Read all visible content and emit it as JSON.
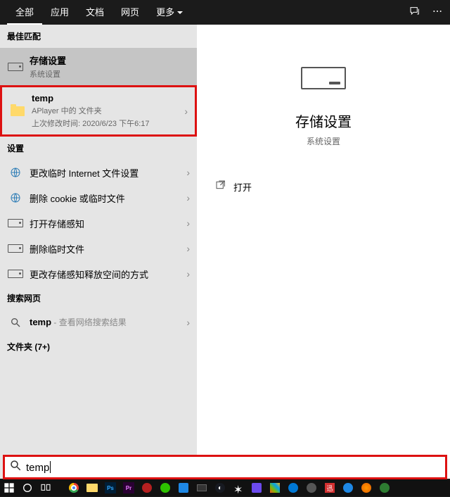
{
  "tabs": {
    "all": "全部",
    "apps": "应用",
    "docs": "文档",
    "web": "网页",
    "more": "更多"
  },
  "sections": {
    "best_match": "最佳匹配",
    "settings": "设置",
    "search_web": "搜索网页",
    "folders": "文件夹 (7+)"
  },
  "storage_item": {
    "title": "存储设置",
    "sub": "系统设置"
  },
  "temp_folder": {
    "title": "temp",
    "sub": "APlayer 中的 文件夹",
    "modified": "上次修改时间: 2020/6/23 下午6:17"
  },
  "settings_items": [
    "更改临时 Internet 文件设置",
    "删除 cookie 或临时文件",
    "打开存储感知",
    "删除临时文件",
    "更改存储感知释放空间的方式"
  ],
  "web_search": {
    "query": "temp",
    "suffix": " - 查看网络搜索结果"
  },
  "preview": {
    "title": "存储设置",
    "sub": "系统设置",
    "open": "打开"
  },
  "search": {
    "value": "temp"
  }
}
